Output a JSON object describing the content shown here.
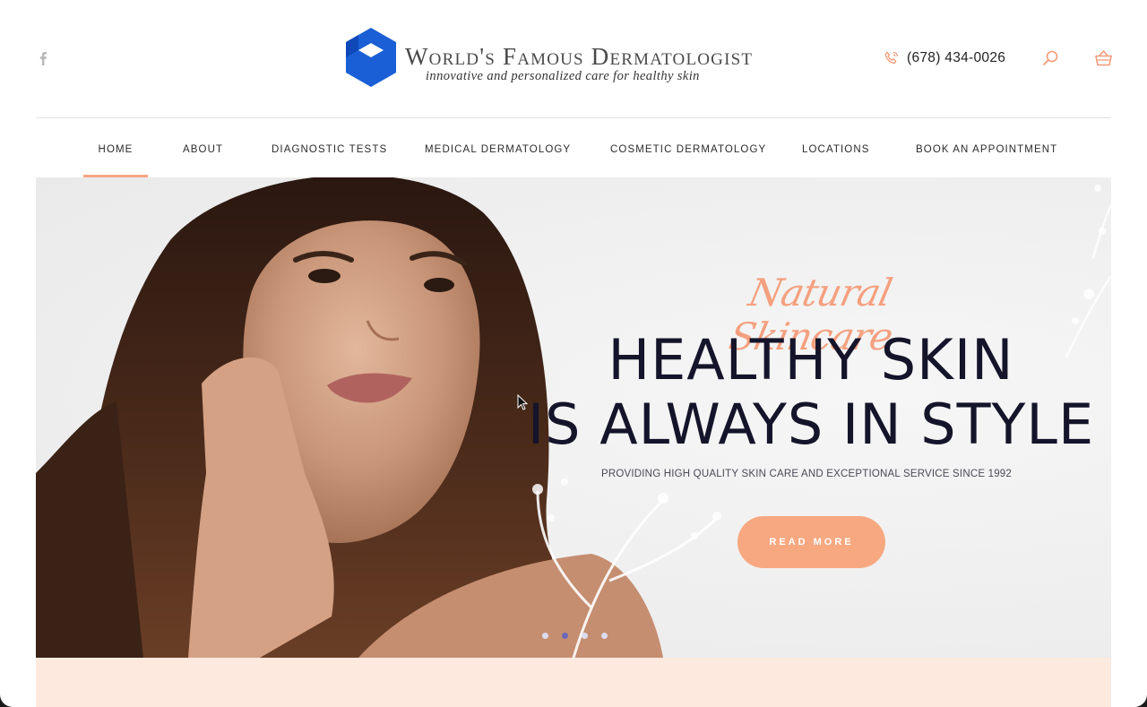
{
  "header": {
    "logo_title": "World's Famous Dermatologist",
    "logo_tagline": "innovative and personalized care for healthy skin",
    "phone": "(678) 434-0026",
    "icons": {
      "social": "facebook-icon",
      "phone": "phone-icon",
      "search": "search-icon",
      "cart": "cart-icon"
    }
  },
  "nav": {
    "items": [
      {
        "label": "HOME",
        "active": true
      },
      {
        "label": "ABOUT"
      },
      {
        "label": "DIAGNOSTIC TESTS"
      },
      {
        "label": "MEDICAL DERMATOLOGY"
      },
      {
        "label": "COSMETIC DERMATOLOGY"
      },
      {
        "label": "LOCATIONS"
      },
      {
        "label": "BOOK AN APPOINTMENT"
      }
    ]
  },
  "hero": {
    "script": "Natural Skincare",
    "headline_line1": "HEALTHY SKIN",
    "headline_line2": "IS ALWAYS IN STYLE",
    "subtitle": "PROVIDING HIGH QUALITY SKIN CARE AND EXCEPTIONAL SERVICE SINCE 1992",
    "button": "READ MORE",
    "slides": {
      "count": 4,
      "active": 2
    }
  },
  "colors": {
    "accent": "#f7a583",
    "brand_blue": "#1a5fd6",
    "headline": "#14142a",
    "strip": "#fde9de",
    "dot_active": "#6b66b8"
  }
}
